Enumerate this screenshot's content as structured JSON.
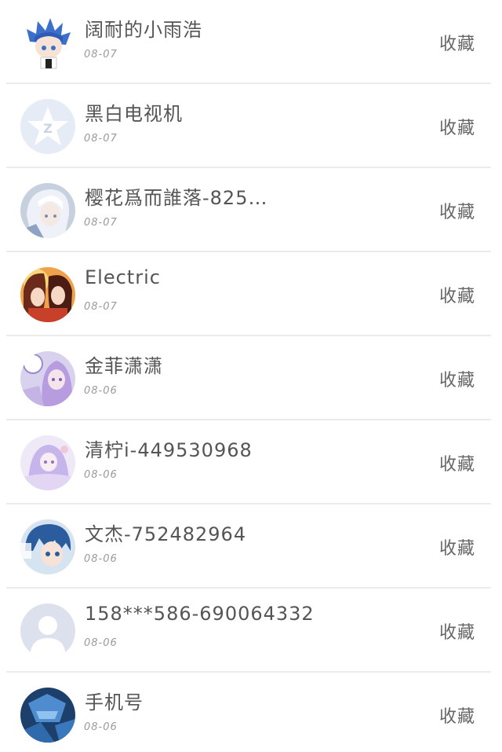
{
  "colors": {
    "text": "#555555",
    "date": "#9a9a9a",
    "divider": "#ebebeb",
    "qq_avatar_bg": "#e6ecf5",
    "default_avatar_bg": "#dde1ee"
  },
  "rows": [
    {
      "name": "阔耐的小雨浩",
      "date": "08-07",
      "action": "收藏",
      "avatar": "anime-blue-hair-avatar"
    },
    {
      "name": "黑白电视机",
      "date": "08-07",
      "action": "收藏",
      "avatar": "qq-default-avatar"
    },
    {
      "name": "樱花爲而誰落-825…",
      "date": "08-07",
      "action": "收藏",
      "avatar": "anime-white-hair-avatar"
    },
    {
      "name": "Electric",
      "date": "08-07",
      "action": "收藏",
      "avatar": "anime-two-girls-avatar"
    },
    {
      "name": "金菲潇潇",
      "date": "08-06",
      "action": "收藏",
      "avatar": "anime-purple-girl-avatar"
    },
    {
      "name": "清柠i-449530968",
      "date": "08-06",
      "action": "收藏",
      "avatar": "anime-lavender-girl-avatar"
    },
    {
      "name": "文杰-752482964",
      "date": "08-06",
      "action": "收藏",
      "avatar": "anime-blue-boy-avatar"
    },
    {
      "name": "158***586-690064332",
      "date": "08-06",
      "action": "收藏",
      "avatar": "default-person-avatar"
    },
    {
      "name": "手机号",
      "date": "08-06",
      "action": "收藏",
      "avatar": "blue-mech-avatar"
    }
  ]
}
